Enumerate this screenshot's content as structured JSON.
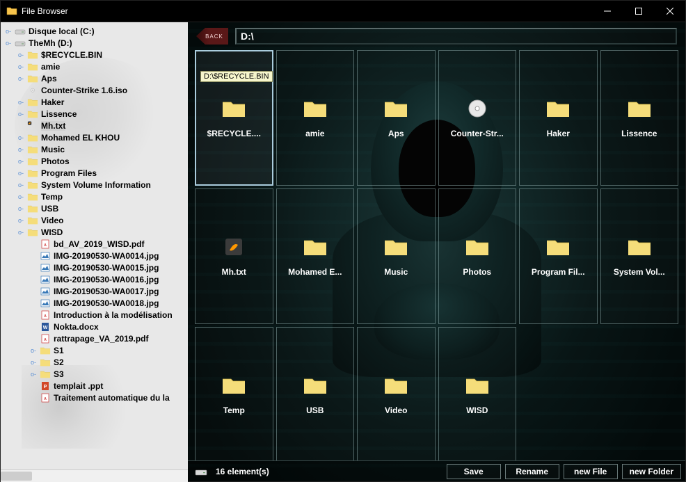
{
  "window": {
    "title": "File Browser"
  },
  "toolbar": {
    "back_label": "BACK",
    "path": "D:\\"
  },
  "tooltip_text": "D:\\$RECYCLE.BIN",
  "tree": [
    {
      "indent": 1,
      "toggle": "o-",
      "icon": "drive",
      "label": "Disque local (C:)"
    },
    {
      "indent": 1,
      "toggle": "o-",
      "icon": "drive",
      "label": "TheMh (D:)"
    },
    {
      "indent": 2,
      "toggle": "o-",
      "icon": "folder",
      "label": "$RECYCLE.BIN"
    },
    {
      "indent": 2,
      "toggle": "o-",
      "icon": "folder",
      "label": "amie"
    },
    {
      "indent": 2,
      "toggle": "o-",
      "icon": "folder",
      "label": "Aps"
    },
    {
      "indent": 2,
      "toggle": "",
      "icon": "disc",
      "label": "Counter-Strike 1.6.iso"
    },
    {
      "indent": 2,
      "toggle": "o-",
      "icon": "folder",
      "label": "Haker"
    },
    {
      "indent": 2,
      "toggle": "o-",
      "icon": "folder",
      "label": "Lissence"
    },
    {
      "indent": 2,
      "toggle": "",
      "icon": "sublime",
      "label": "Mh.txt",
      "selected": true
    },
    {
      "indent": 2,
      "toggle": "o-",
      "icon": "folder",
      "label": "Mohamed EL KHOU"
    },
    {
      "indent": 2,
      "toggle": "o-",
      "icon": "folder",
      "label": "Music"
    },
    {
      "indent": 2,
      "toggle": "o-",
      "icon": "folder",
      "label": "Photos"
    },
    {
      "indent": 2,
      "toggle": "o-",
      "icon": "folder",
      "label": "Program Files"
    },
    {
      "indent": 2,
      "toggle": "o-",
      "icon": "folder",
      "label": "System Volume Information"
    },
    {
      "indent": 2,
      "toggle": "o-",
      "icon": "folder",
      "label": "Temp"
    },
    {
      "indent": 2,
      "toggle": "o-",
      "icon": "folder",
      "label": "USB"
    },
    {
      "indent": 2,
      "toggle": "o-",
      "icon": "folder",
      "label": "Video"
    },
    {
      "indent": 2,
      "toggle": "o-",
      "icon": "folder",
      "label": "WISD"
    },
    {
      "indent": 3,
      "toggle": "",
      "icon": "pdf",
      "label": "bd_AV_2019_WISD.pdf"
    },
    {
      "indent": 3,
      "toggle": "",
      "icon": "img",
      "label": "IMG-20190530-WA0014.jpg"
    },
    {
      "indent": 3,
      "toggle": "",
      "icon": "img",
      "label": "IMG-20190530-WA0015.jpg"
    },
    {
      "indent": 3,
      "toggle": "",
      "icon": "img",
      "label": "IMG-20190530-WA0016.jpg"
    },
    {
      "indent": 3,
      "toggle": "",
      "icon": "img",
      "label": "IMG-20190530-WA0017.jpg"
    },
    {
      "indent": 3,
      "toggle": "",
      "icon": "img",
      "label": "IMG-20190530-WA0018.jpg"
    },
    {
      "indent": 3,
      "toggle": "",
      "icon": "pdf",
      "label": "Introduction à la modélisation"
    },
    {
      "indent": 3,
      "toggle": "",
      "icon": "word",
      "label": "Nokta.docx"
    },
    {
      "indent": 3,
      "toggle": "",
      "icon": "pdf",
      "label": "rattrapage_VA_2019.pdf"
    },
    {
      "indent": 3,
      "toggle": "o-",
      "icon": "folder",
      "label": "S1"
    },
    {
      "indent": 3,
      "toggle": "o-",
      "icon": "folder",
      "label": "S2"
    },
    {
      "indent": 3,
      "toggle": "o-",
      "icon": "folder",
      "label": "S3"
    },
    {
      "indent": 3,
      "toggle": "",
      "icon": "ppt",
      "label": "templait .ppt"
    },
    {
      "indent": 3,
      "toggle": "",
      "icon": "pdf",
      "label": "Traitement automatique du la"
    }
  ],
  "grid": [
    {
      "icon": "folder",
      "label": "$RECYCLE....",
      "selected": true
    },
    {
      "icon": "folder",
      "label": "amie"
    },
    {
      "icon": "folder",
      "label": "Aps"
    },
    {
      "icon": "disc",
      "label": "Counter-Str..."
    },
    {
      "icon": "folder",
      "label": "Haker"
    },
    {
      "icon": "folder",
      "label": "Lissence"
    },
    {
      "icon": "sublime",
      "label": "Mh.txt"
    },
    {
      "icon": "folder",
      "label": "Mohamed E..."
    },
    {
      "icon": "folder",
      "label": "Music"
    },
    {
      "icon": "folder",
      "label": "Photos"
    },
    {
      "icon": "folder",
      "label": "Program Fil..."
    },
    {
      "icon": "folder",
      "label": "System Vol..."
    },
    {
      "icon": "folder",
      "label": "Temp"
    },
    {
      "icon": "folder",
      "label": "USB"
    },
    {
      "icon": "folder",
      "label": "Video"
    },
    {
      "icon": "folder",
      "label": "WISD"
    }
  ],
  "bottombar": {
    "count": "16 element(s)",
    "actions": {
      "save": "Save",
      "rename": "Rename",
      "newfile": "new File",
      "newfolder": "new Folder"
    }
  }
}
